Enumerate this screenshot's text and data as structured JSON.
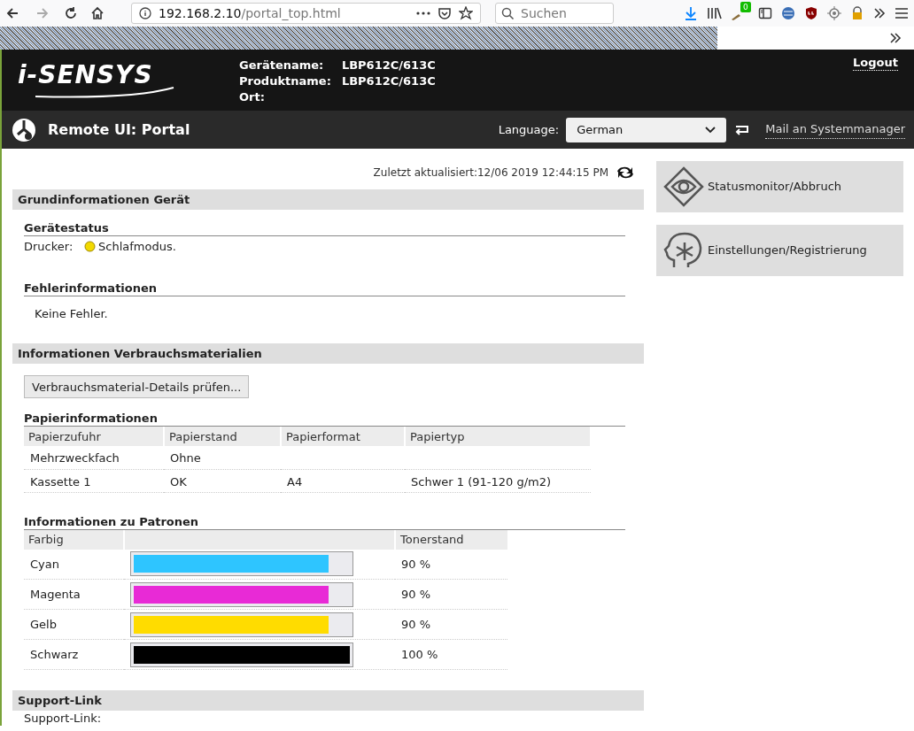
{
  "browser": {
    "url_host": "192.168.2.10",
    "url_path": "/portal_top.html",
    "search_placeholder": "Suchen",
    "addon_badge": "0"
  },
  "header": {
    "logo": "i-SENSYS",
    "device_info": [
      {
        "label": "Gerätename:",
        "value": "LBP612C/613C"
      },
      {
        "label": "Produktname:",
        "value": "LBP612C/613C"
      },
      {
        "label": "Ort:"
      }
    ],
    "logout": "Logout"
  },
  "nav": {
    "title": "Remote UI: Portal",
    "language_label": "Language:",
    "language": "German",
    "mail_link": "Mail an Systemmanager"
  },
  "last_updated": "Zuletzt aktualisiert:12/06 2019 12:44:15 PM",
  "basic": {
    "title": "Grundinformationen Gerät",
    "status_title": "Gerätestatus",
    "status_label": "Drucker:",
    "status_value": "Schlafmodus.",
    "error_title": "Fehlerinformationen",
    "error_value": "Keine Fehler."
  },
  "consumables": {
    "title": "Informationen Verbrauchsmaterialien",
    "details_button": "Verbrauchsmaterial-Details prüfen...",
    "paper_title": "Papierinformationen",
    "paper_columns": [
      "Papierzufuhr",
      "Papierstand",
      "Papierformat",
      "Papiertyp"
    ],
    "paper_rows": [
      [
        "Mehrzweckfach",
        "Ohne",
        "",
        ""
      ],
      [
        "Kassette 1",
        "OK",
        "A4",
        "Schwer 1 (91-120 g/m2)"
      ]
    ],
    "cartridge_title": "Informationen zu Patronen",
    "cartridge_columns": {
      "column_1": "Farbig",
      "toner": "Tonerstand"
    },
    "cartridges": [
      {
        "name": "Cyan",
        "color": "#2ec5ff",
        "level": 0.9,
        "reading": "90 %"
      },
      {
        "name": "Magenta",
        "color": "#e82ad6",
        "level": 0.9,
        "reading": "90 %"
      },
      {
        "name": "Gelb",
        "color": "#ffdc00",
        "level": 0.9,
        "reading": "90 %"
      },
      {
        "name": "Schwarz",
        "color": "#000000",
        "level": 1.0,
        "reading": "100 %"
      }
    ]
  },
  "support": {
    "title": "Support-Link",
    "label": "Support-Link:"
  },
  "side_buttons": [
    {
      "kind": "monitor",
      "label": "Statusmonitor/Abbruch"
    },
    {
      "kind": "settings",
      "label": "Einstellungen/Registrierung"
    }
  ]
}
